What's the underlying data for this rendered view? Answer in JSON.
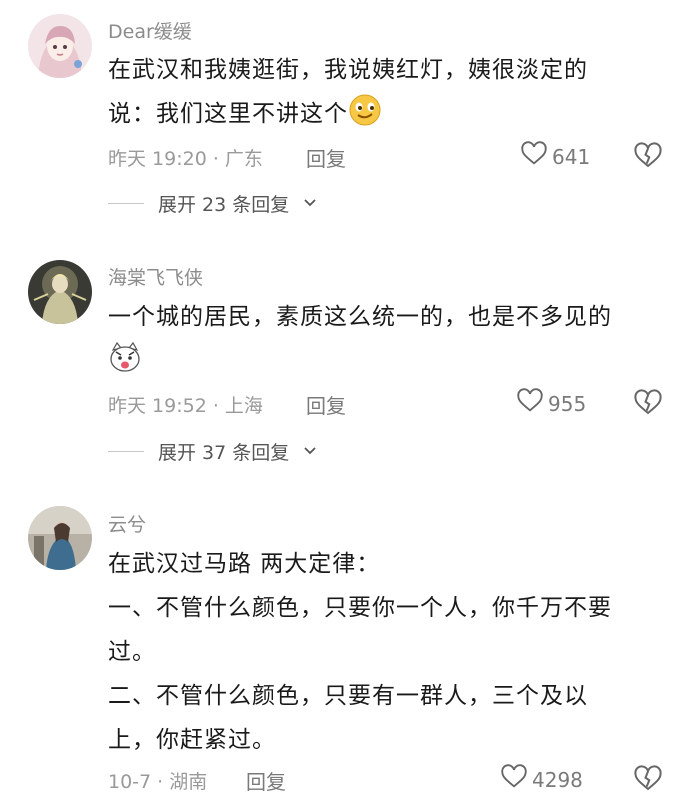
{
  "comments": [
    {
      "username": "Dear缓缓",
      "text_lines": [
        "在武汉和我姨逛街，我说姨红灯，姨很淡定的",
        "说：我们这里不讲这个"
      ],
      "time_location": "昨天 19:20 · 广东",
      "reply_label": "回复",
      "like_count": "641",
      "expand_label": "展开 23 条回复"
    },
    {
      "username": "海棠飞飞侠",
      "text_lines": [
        "一个城的居民，素质这么统一的，也是不多见的"
      ],
      "time_location": "昨天 19:52 · 上海",
      "reply_label": "回复",
      "like_count": "955",
      "expand_label": "展开 37 条回复"
    },
    {
      "username": "云兮",
      "text_lines": [
        "在武汉过马路 两大定律：",
        "一、不管什么颜色，只要你一个人，你千万不要",
        "过。",
        "二、不管什么颜色，只要有一群人，三个及以",
        "上，你赶紧过。"
      ],
      "time_location": "10-7 · 湖南",
      "reply_label": "回复",
      "like_count": "4298"
    }
  ],
  "icons": {
    "like": "heart-outline-icon",
    "dislike": "broken-heart-icon",
    "expand": "chevron-down-icon",
    "emoji_1": "smirk-face-emoji",
    "emoji_2": "cat-face-emoji"
  },
  "colors": {
    "text": "#1a1a1a",
    "meta": "#9a9a9a",
    "background": "#ffffff"
  }
}
